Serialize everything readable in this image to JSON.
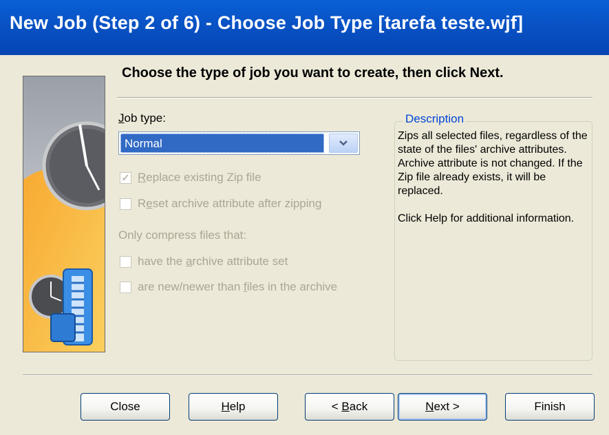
{
  "window": {
    "title": "New Job (Step 2 of 6) - Choose Job Type [tarefa teste.wjf]"
  },
  "heading": "Choose the type of job you want to create, then click Next.",
  "job_type": {
    "label_pre": "",
    "label_ul": "J",
    "label_post": "ob type:",
    "selected": "Normal"
  },
  "checkboxes": {
    "replace": {
      "pre": "",
      "ul": "R",
      "post": "eplace existing Zip file",
      "checked": true
    },
    "reset": {
      "pre": "R",
      "ul": "e",
      "post": "set archive attribute after zipping",
      "checked": false
    }
  },
  "only_compress_label": "Only compress files that:",
  "filters": {
    "archive_attr": {
      "pre": "have the ",
      "ul": "a",
      "post": "rchive attribute set",
      "checked": false
    },
    "newer": {
      "pre": "are new/newer than ",
      "ul": "f",
      "post": "iles in the archive",
      "checked": false
    }
  },
  "description": {
    "title": "Description",
    "body": "Zips all selected files, regardless of the state of the files' archive attributes. Archive attribute is not changed.  If the Zip file already exists, it will be replaced.",
    "help": "Click Help for additional information."
  },
  "buttons": {
    "close": {
      "pre": "Close",
      "ul": "",
      "post": ""
    },
    "help": {
      "pre": "",
      "ul": "H",
      "post": "elp"
    },
    "back": {
      "pre": "< ",
      "ul": "B",
      "post": "ack"
    },
    "next": {
      "pre": "",
      "ul": "N",
      "post": "ext >"
    },
    "finish": {
      "pre": "Finish",
      "ul": "",
      "post": ""
    }
  },
  "colors": {
    "title_bar": "#0a5fd6",
    "dialog_bg": "#ece9d8",
    "selection": "#316ac5",
    "group_title": "#0046d5",
    "disabled_text": "#a9a693"
  },
  "icons": {
    "banner": "clock-zip-banner-image",
    "combo_arrow": "chevron-down-icon"
  }
}
